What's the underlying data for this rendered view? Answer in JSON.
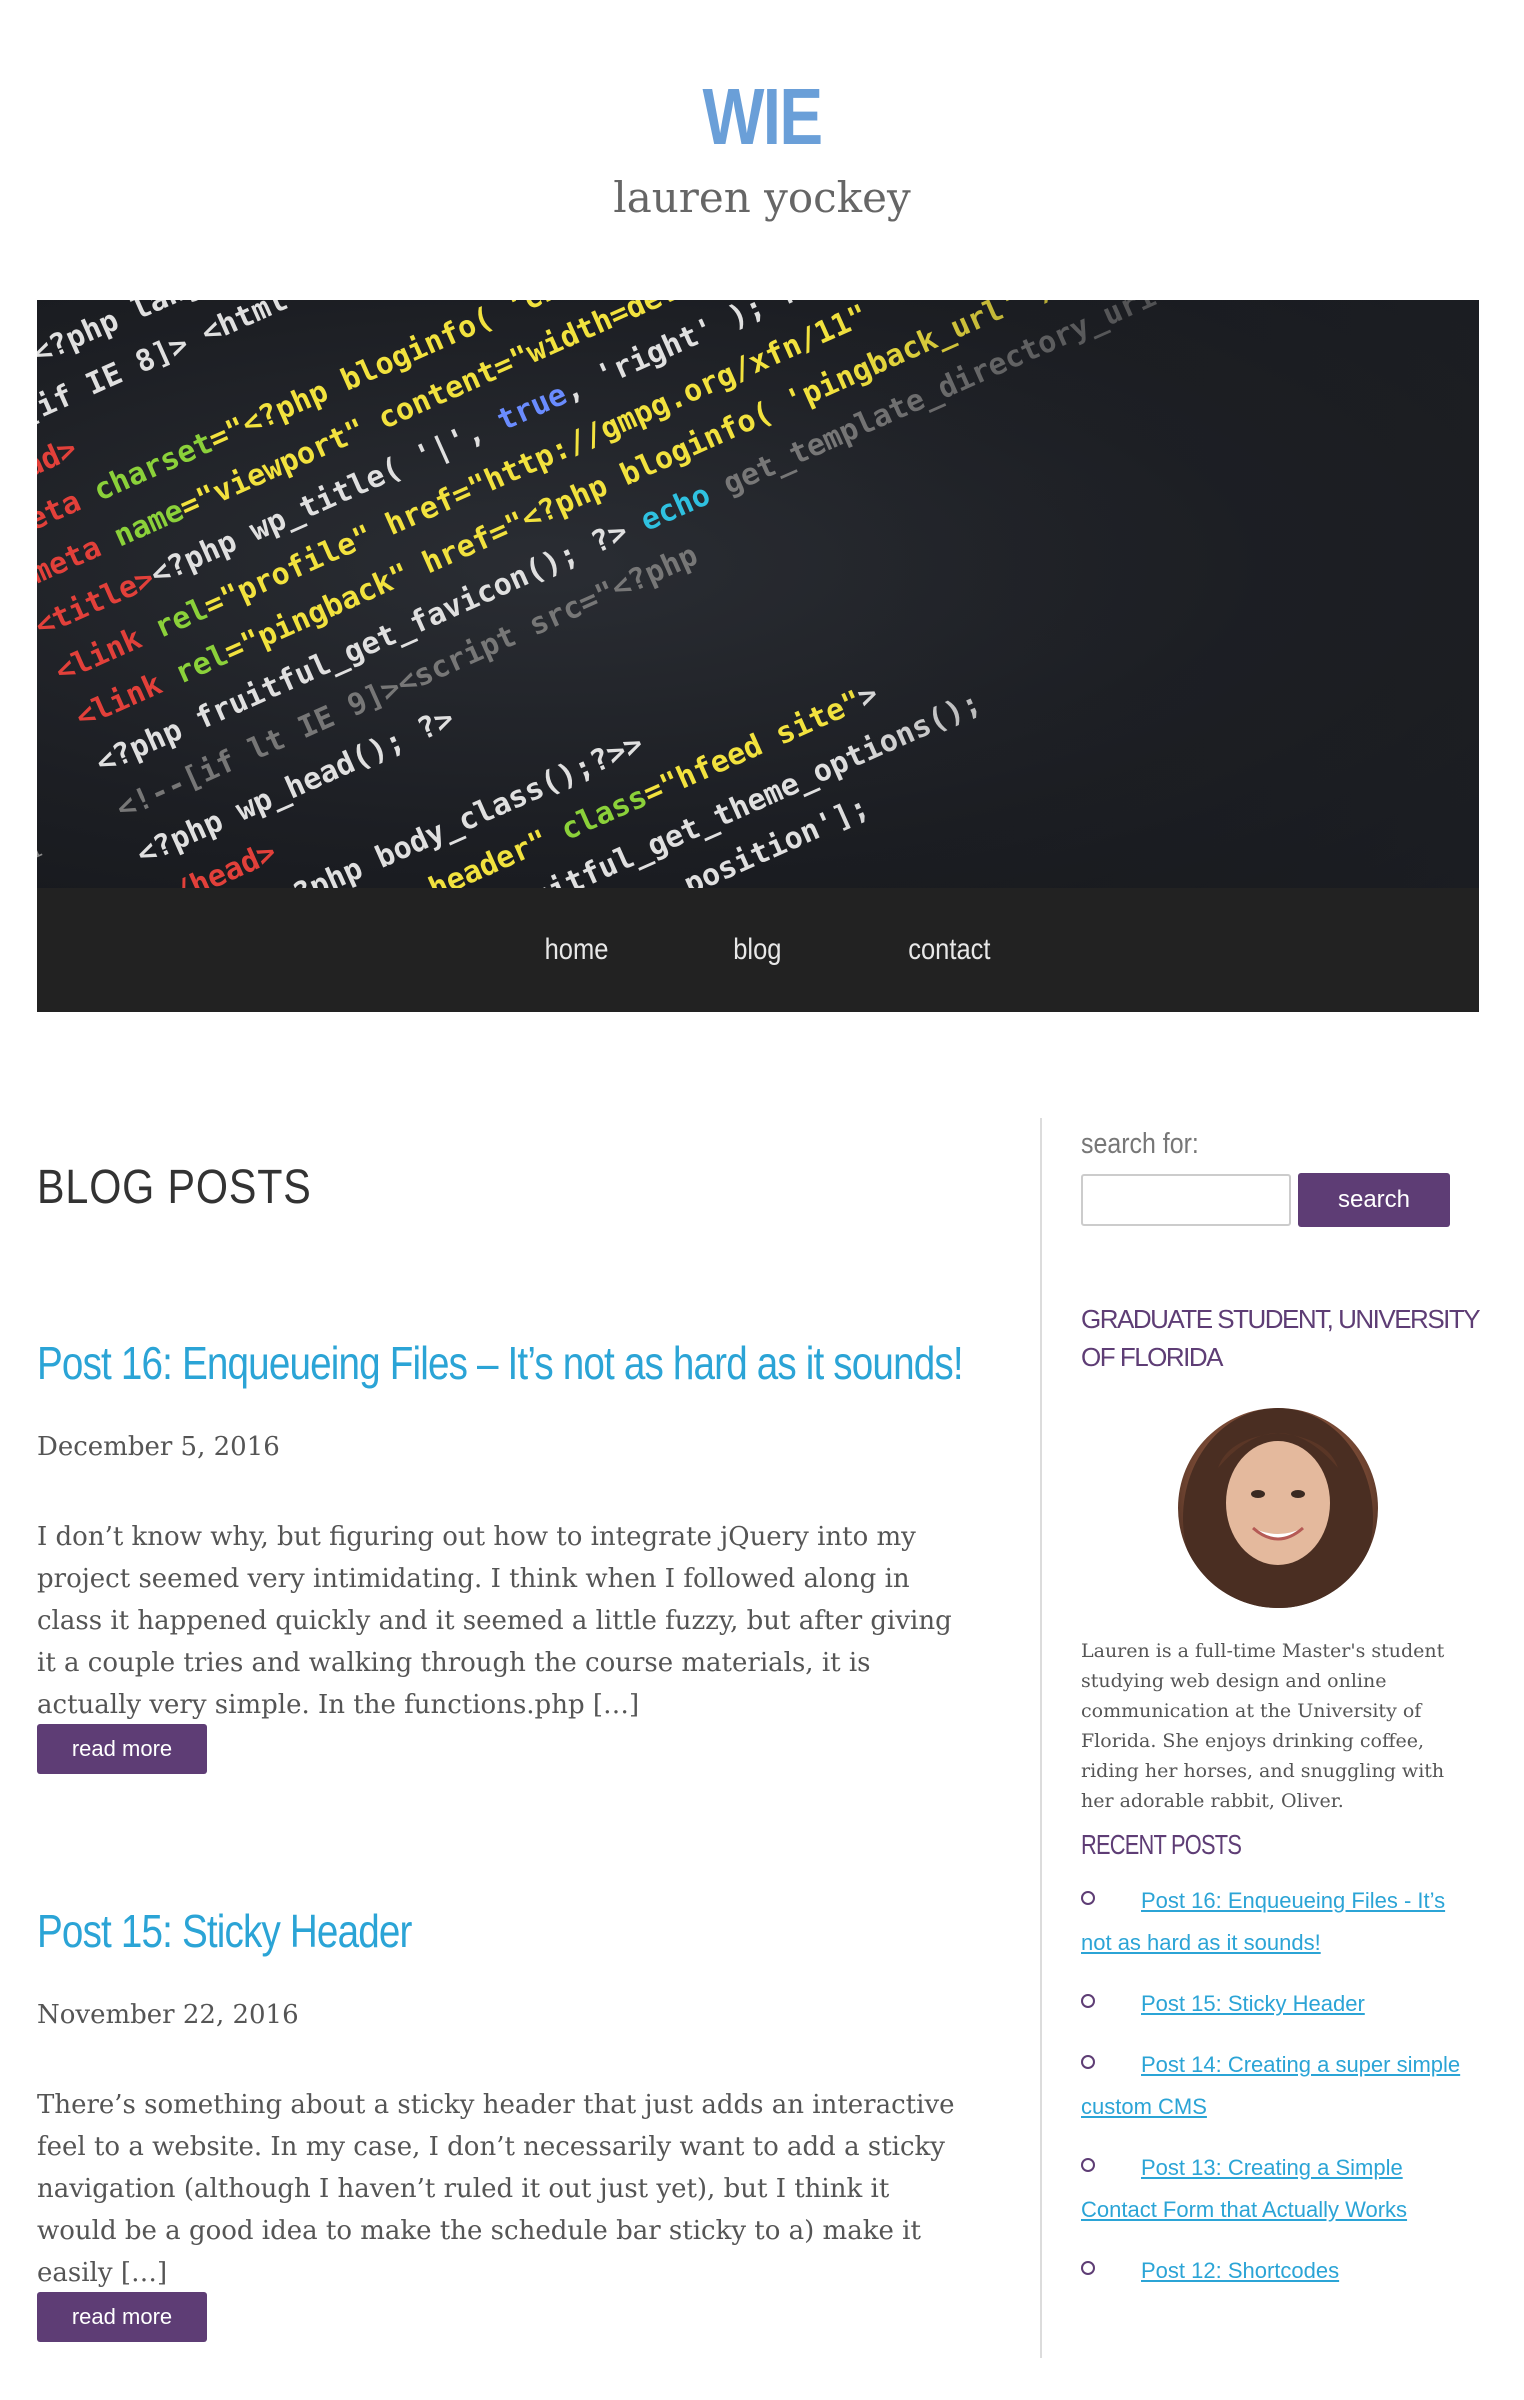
{
  "header": {
    "site_title": "WIE",
    "site_subtitle": "lauren yockey"
  },
  "nav": {
    "items": [
      {
        "label": "home"
      },
      {
        "label": "blog"
      },
      {
        "label": "contact"
      }
    ]
  },
  "main": {
    "section_title": "BLOG POSTS",
    "posts": [
      {
        "title": "Post 16: Enqueueing Files – It’s not as hard as it sounds!",
        "date": "December 5, 2016",
        "excerpt": "I don’t know why, but figuring out how to integrate jQuery into my project seemed very intimidating. I think when I followed along in class it happened quickly and it seemed a little fuzzy, but after giving it a couple tries and walking through the course materials, it is actually very simple. In the functions.php […]",
        "button": "read more"
      },
      {
        "title": "Post 15: Sticky Header",
        "date": "November 22, 2016",
        "excerpt": "There’s something about a sticky header that just adds an interactive feel to a website. In my case, I don’t necessarily want to add a sticky navigation (although I haven’t ruled it out just yet), but I think it would be a good idea to make the schedule bar sticky to a) make it easily […]",
        "button": "read more"
      }
    ]
  },
  "sidebar": {
    "search_label": "search for:",
    "search_value": "",
    "search_button": "search",
    "profile_title": "GRADUATE STUDENT, UNIVERSITY OF FLORIDA",
    "bio": "Lauren is a full-time Master's student studying web design and online communication at the University of Florida. She enjoys drinking coffee, riding her horses, and snuggling with her adorable rabbit, Oliver.",
    "recent_title": "RECENT POSTS",
    "recent_posts": [
      {
        "label": "Post 16: Enqueueing Files - It’s not as hard as it sounds!"
      },
      {
        "label": "Post 15: Sticky Header"
      },
      {
        "label": "Post 14: Creating a super simple custom CMS"
      },
      {
        "label": "Post 13: Creating a Simple Contact Form that Actually Works"
      },
      {
        "label": "Post 12: Shortcodes"
      }
    ]
  },
  "colors": {
    "title_blue": "#6a9fd8",
    "link_blue": "#2ba4d6",
    "accent_purple": "#5e3d75",
    "nav_bg": "#222222"
  }
}
